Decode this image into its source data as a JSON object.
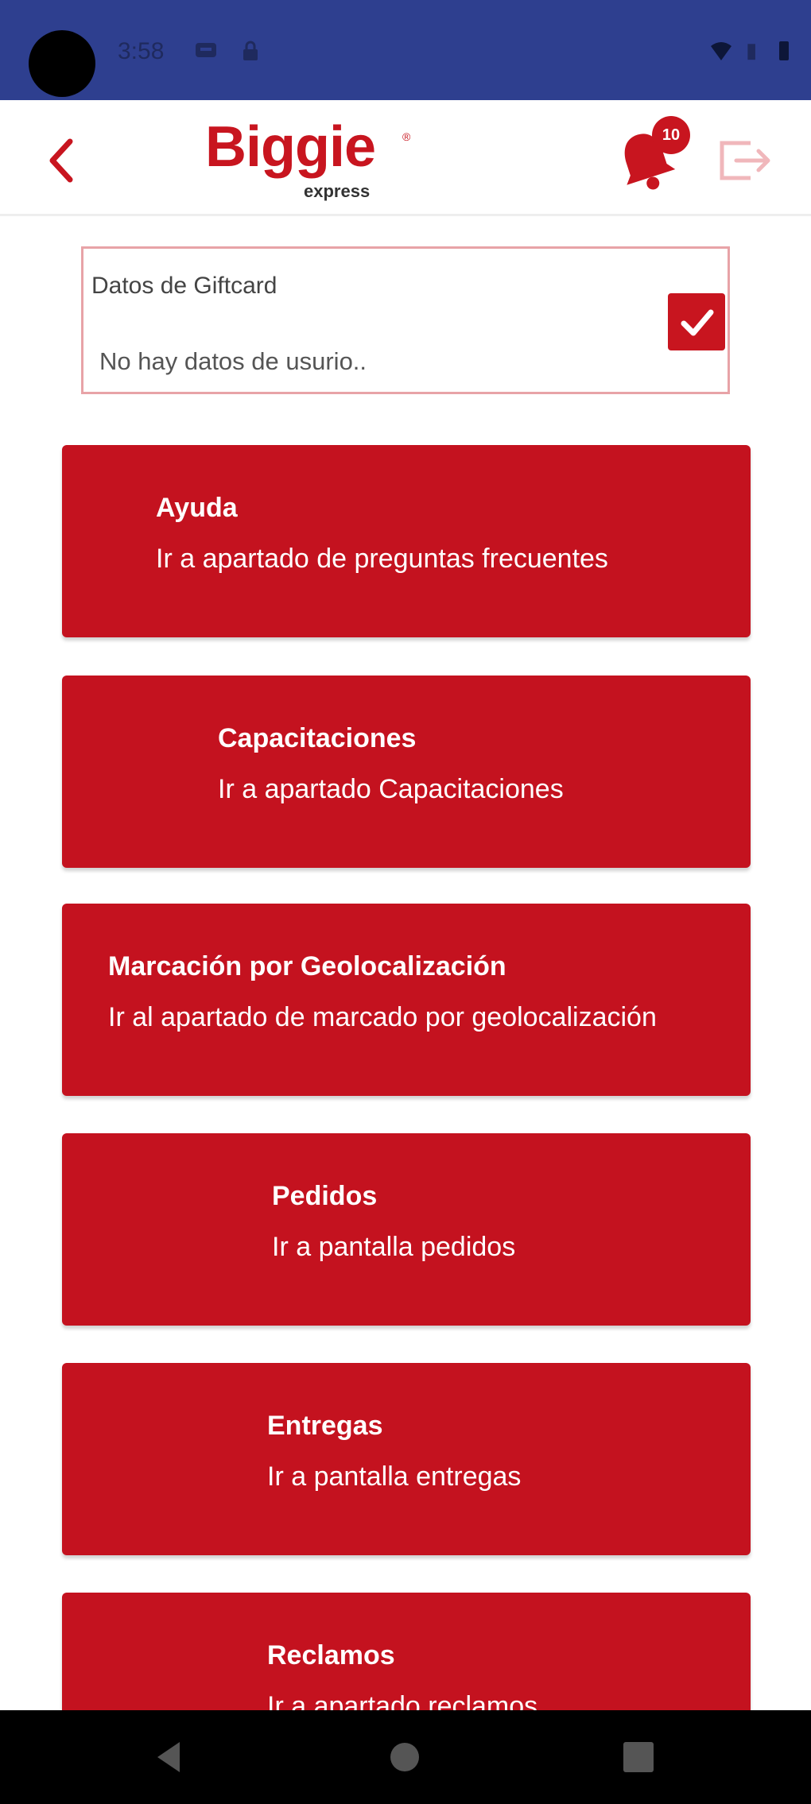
{
  "status_bar": {
    "time": "3:58",
    "icons": [
      "message-icon",
      "lock-icon",
      "wifi-icon",
      "signal-icon",
      "battery-icon"
    ],
    "color": "#2e3f8f"
  },
  "app_bar": {
    "back_icon": "chevron-left-icon",
    "brand": "Biggie",
    "brand_sub": "express",
    "notification_count": "10",
    "logout_icon": "logout-icon"
  },
  "giftcard": {
    "title": "Datos de Giftcard",
    "message": "No hay datos de usurio..",
    "checked": true
  },
  "menu": [
    {
      "title": "Ayuda",
      "subtitle": "Ir a apartado de preguntas frecuentes"
    },
    {
      "title": "Capacitaciones",
      "subtitle": "Ir a apartado Capacitaciones"
    },
    {
      "title": "Marcación por Geolocalización",
      "subtitle": "Ir al apartado de marcado por geolocalización"
    },
    {
      "title": "Pedidos",
      "subtitle": "Ir a pantalla pedidos"
    },
    {
      "title": "Entregas",
      "subtitle": "Ir a pantalla entregas"
    },
    {
      "title": "Reclamos",
      "subtitle": "Ir a apartado reclamos"
    }
  ],
  "nav_bar": {
    "buttons": [
      "back-nav-icon",
      "home-nav-icon",
      "recents-nav-icon"
    ]
  },
  "colors": {
    "brand_red": "#c4121f",
    "status_blue": "#2e3f8f"
  }
}
